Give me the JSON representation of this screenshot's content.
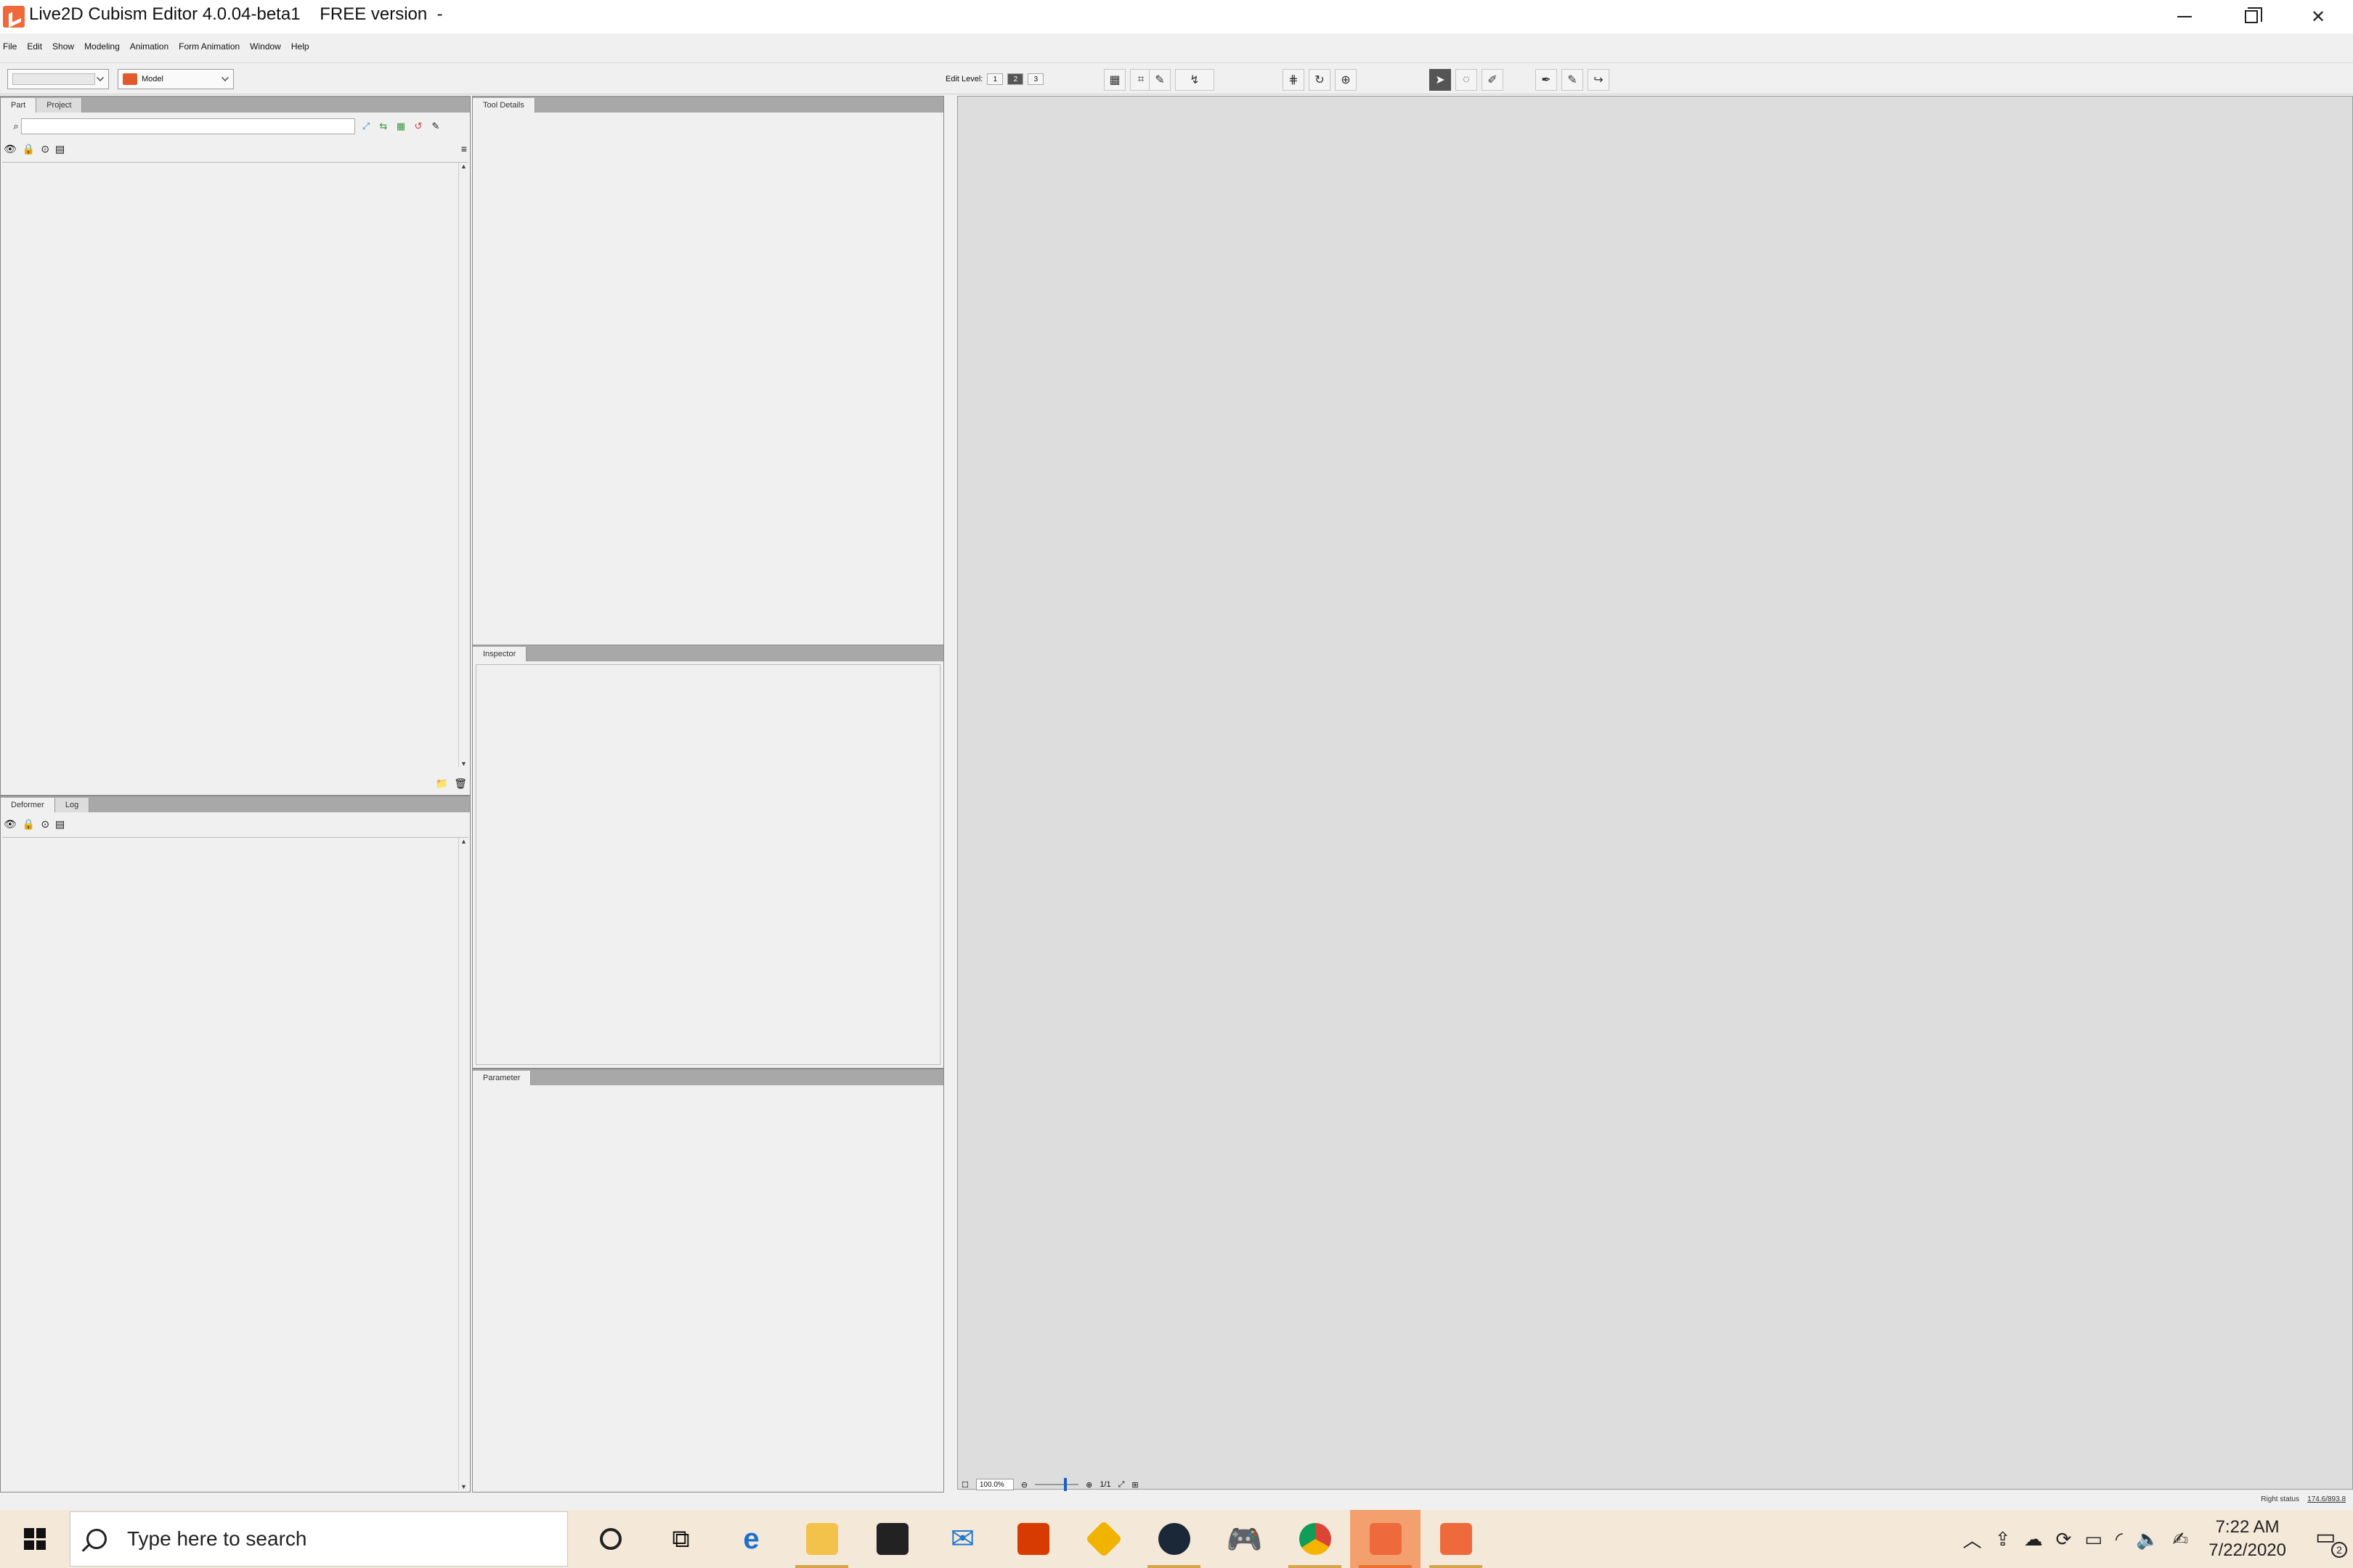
{
  "window": {
    "title": "Live2D Cubism Editor 4.0.04-beta1    FREE version  -"
  },
  "menu": [
    "File",
    "Edit",
    "Show",
    "Modeling",
    "Animation",
    "Form Animation",
    "Window",
    "Help"
  ],
  "toolbar": {
    "combo1_value": "",
    "combo2_value": "Model",
    "edit_level_label": "Edit Level:",
    "edit_levels": [
      "1",
      "2",
      "3"
    ],
    "active_edit_level": "2"
  },
  "panels": {
    "part_tabs": [
      "Part",
      "Project"
    ],
    "deformer_tabs": [
      "Deformer",
      "Log"
    ],
    "tool_details": "Tool Details",
    "inspector": "Inspector",
    "parameter": "Parameter"
  },
  "viewport": {
    "zoom": "100.0%",
    "ratio": "1/1",
    "right_status_label": "Right status",
    "right_status_value": "174.6/893.8"
  },
  "taskbar": {
    "search_placeholder": "Type here to search",
    "time": "7:22 AM",
    "date": "7/22/2020",
    "notification_count": "2"
  },
  "colors": {
    "accent": "#ee6a3c",
    "taskbar": "#f4e8d8",
    "active_task": "#f3a06e",
    "viewport_bg": "#dddddd"
  }
}
